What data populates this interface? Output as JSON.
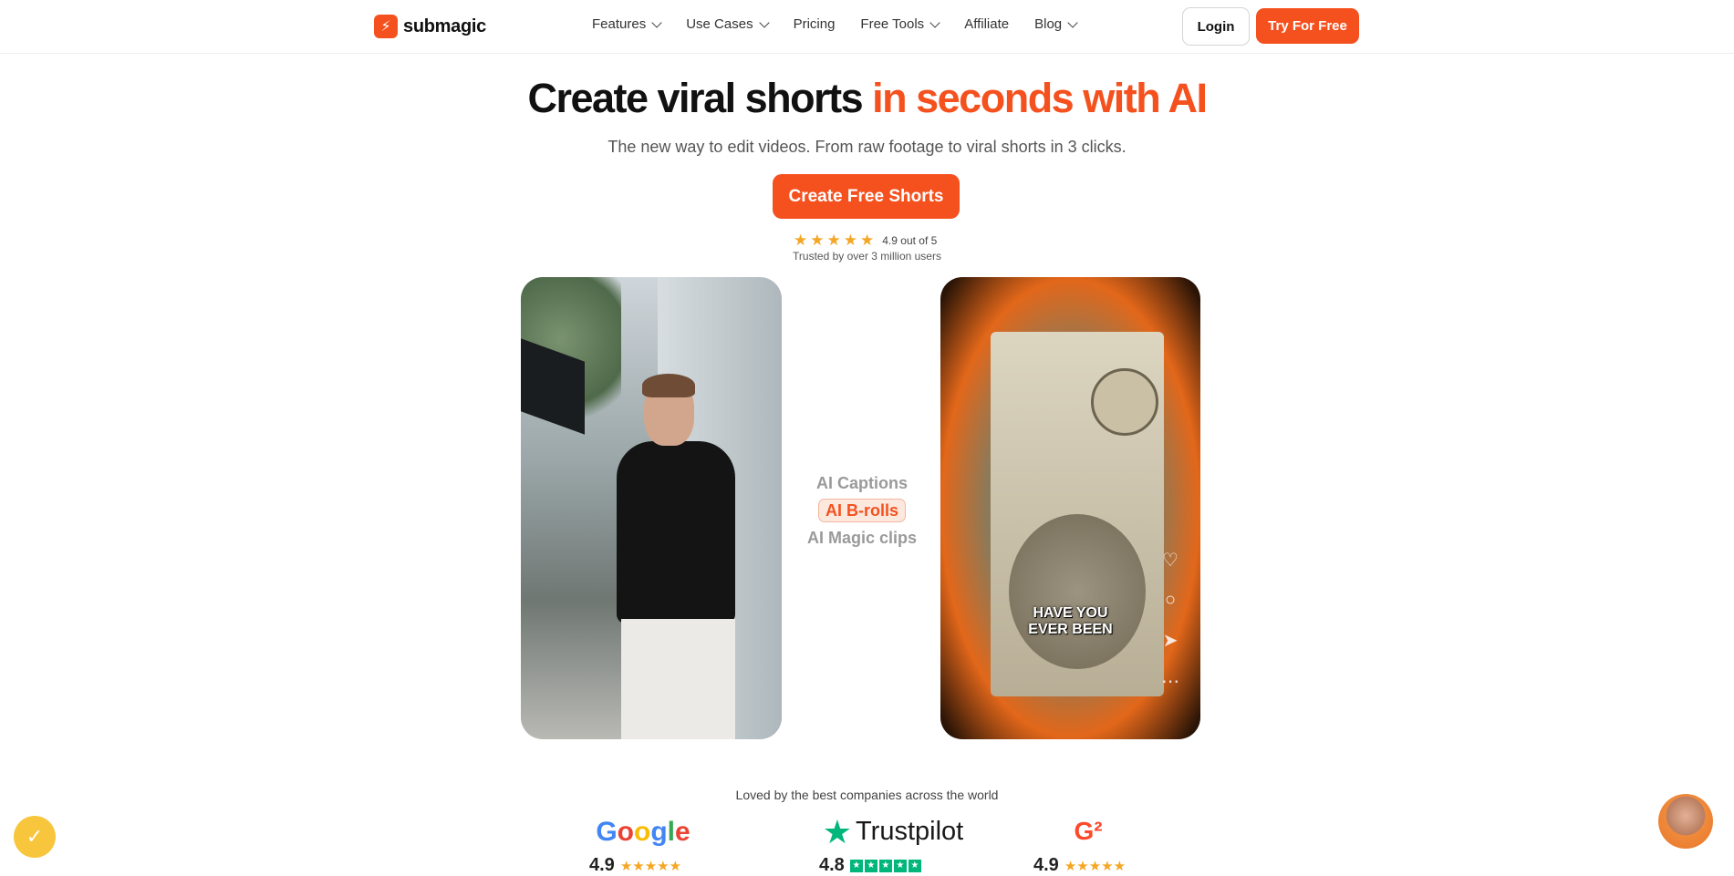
{
  "nav": {
    "logo_text": "submagic",
    "items": [
      {
        "label": "Features",
        "has_dropdown": true
      },
      {
        "label": "Use Cases",
        "has_dropdown": true
      },
      {
        "label": "Pricing",
        "has_dropdown": false
      },
      {
        "label": "Free Tools",
        "has_dropdown": true
      },
      {
        "label": "Affiliate",
        "has_dropdown": false
      },
      {
        "label": "Blog",
        "has_dropdown": true
      }
    ],
    "login_label": "Login",
    "try_label": "Try For Free"
  },
  "hero": {
    "title_main": "Create viral shorts ",
    "title_accent": "in seconds with AI",
    "subtitle": "The new way to edit videos. From raw footage to viral shorts in 3 clicks.",
    "cta_label": "Create Free Shorts",
    "rating_text": "4.9 out of 5",
    "rating_stars": 5,
    "trusted_text": "Trusted by over 3 million users"
  },
  "demo": {
    "features": [
      "AI Captions",
      "AI B-rolls",
      "AI Magic clips"
    ],
    "active_feature": "AI B-rolls",
    "caption_line1": "HAVE YOU",
    "caption_line2": "EVER BEEN"
  },
  "social_proof": {
    "heading": "Loved by the best companies across the world",
    "google_score": "4.9",
    "trustpilot_label": "Trustpilot",
    "trustpilot_score": "4.8",
    "g2_score": "4.9"
  },
  "colors": {
    "accent": "#f4511e",
    "star": "#f5a623",
    "trustpilot_green": "#00b67a"
  }
}
